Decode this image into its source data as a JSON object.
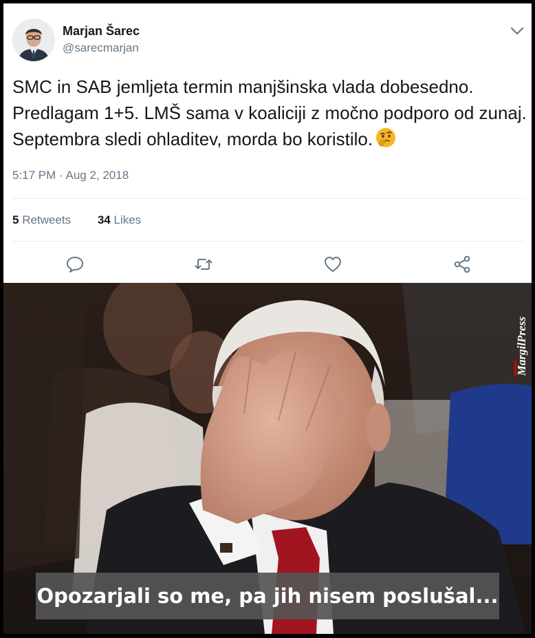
{
  "tweet": {
    "author_name": "Marjan Šarec",
    "author_handle": "@sarecmarjan",
    "text": "SMC in SAB jemljeta termin manjšinska vlada dobesedno. Predlagam 1+5. LMŠ sama v koaliciji z močno podporo od zunaj. Septembra sledi ohladitev, morda bo koristilo.",
    "emoji_icon": "thinking-face-icon",
    "timestamp": "5:17 PM · Aug 2, 2018",
    "retweets_count": "5",
    "retweets_label": "Retweets",
    "likes_count": "34",
    "likes_label": "Likes",
    "actions": [
      "reply-icon",
      "retweet-icon",
      "like-icon",
      "share-icon"
    ],
    "colors": {
      "text": "#14171a",
      "secondary": "#657786",
      "divider": "#e6ecf0"
    }
  },
  "meme": {
    "caption": "Opozarjali so me, pa jih nisem poslušal...",
    "watermark": "MargilPress"
  }
}
